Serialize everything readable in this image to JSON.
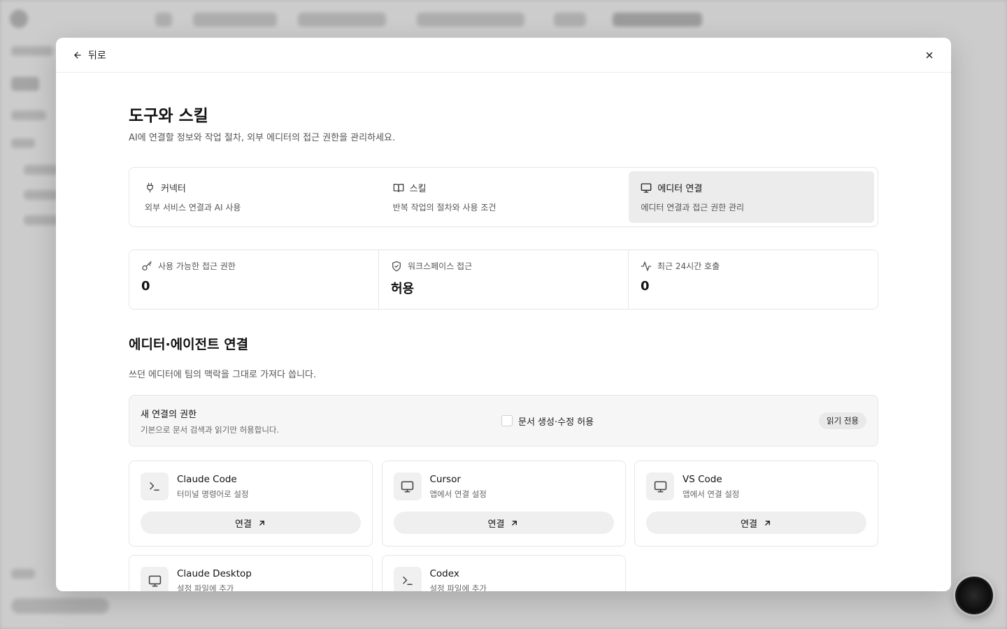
{
  "modal": {
    "back_label": "뒤로"
  },
  "page": {
    "title": "도구와 스킬",
    "description": "AI에 연결할 정보와 작업 절차, 외부 에디터의 접근 권한을 관리하세요."
  },
  "tabs": [
    {
      "label": "커넥터",
      "sub": "외부 서비스 연결과 AI 사용",
      "icon": "plug-icon",
      "active": false
    },
    {
      "label": "스킬",
      "sub": "반복 작업의 절차와 사용 조건",
      "icon": "book-icon",
      "active": false
    },
    {
      "label": "에디터 연결",
      "sub": "에디터 연결과 접근 권한 관리",
      "icon": "monitor-icon",
      "active": true
    }
  ],
  "stats": [
    {
      "label": "사용 가능한 접근 권한",
      "value": "0",
      "icon": "key-icon"
    },
    {
      "label": "워크스페이스 접근",
      "value": "허용",
      "icon": "shield-check-icon"
    },
    {
      "label": "최근 24시간 호출",
      "value": "0",
      "icon": "activity-icon"
    }
  ],
  "section": {
    "title": "에디터·에이전트 연결",
    "description": "쓰던 에디터에 팀의 맥락을 그대로 가져다 씁니다."
  },
  "permission": {
    "title": "새 연결의 권한",
    "sub": "기본으로 문서 검색과 읽기만 허용합니다.",
    "checkbox_label": "문서 생성·수정 허용",
    "checked": false,
    "badge": "읽기 전용"
  },
  "connect_label": "연결",
  "cards": [
    {
      "name": "Claude Code",
      "sub": "터미널 명령어로 설정",
      "icon": "terminal-icon"
    },
    {
      "name": "Cursor",
      "sub": "앱에서 연결 설정",
      "icon": "monitor-icon"
    },
    {
      "name": "VS Code",
      "sub": "앱에서 연결 설정",
      "icon": "monitor-icon"
    },
    {
      "name": "Claude Desktop",
      "sub": "설정 파일에 추가",
      "icon": "monitor-icon"
    },
    {
      "name": "Codex",
      "sub": "설정 파일에 추가",
      "icon": "terminal-icon"
    }
  ]
}
